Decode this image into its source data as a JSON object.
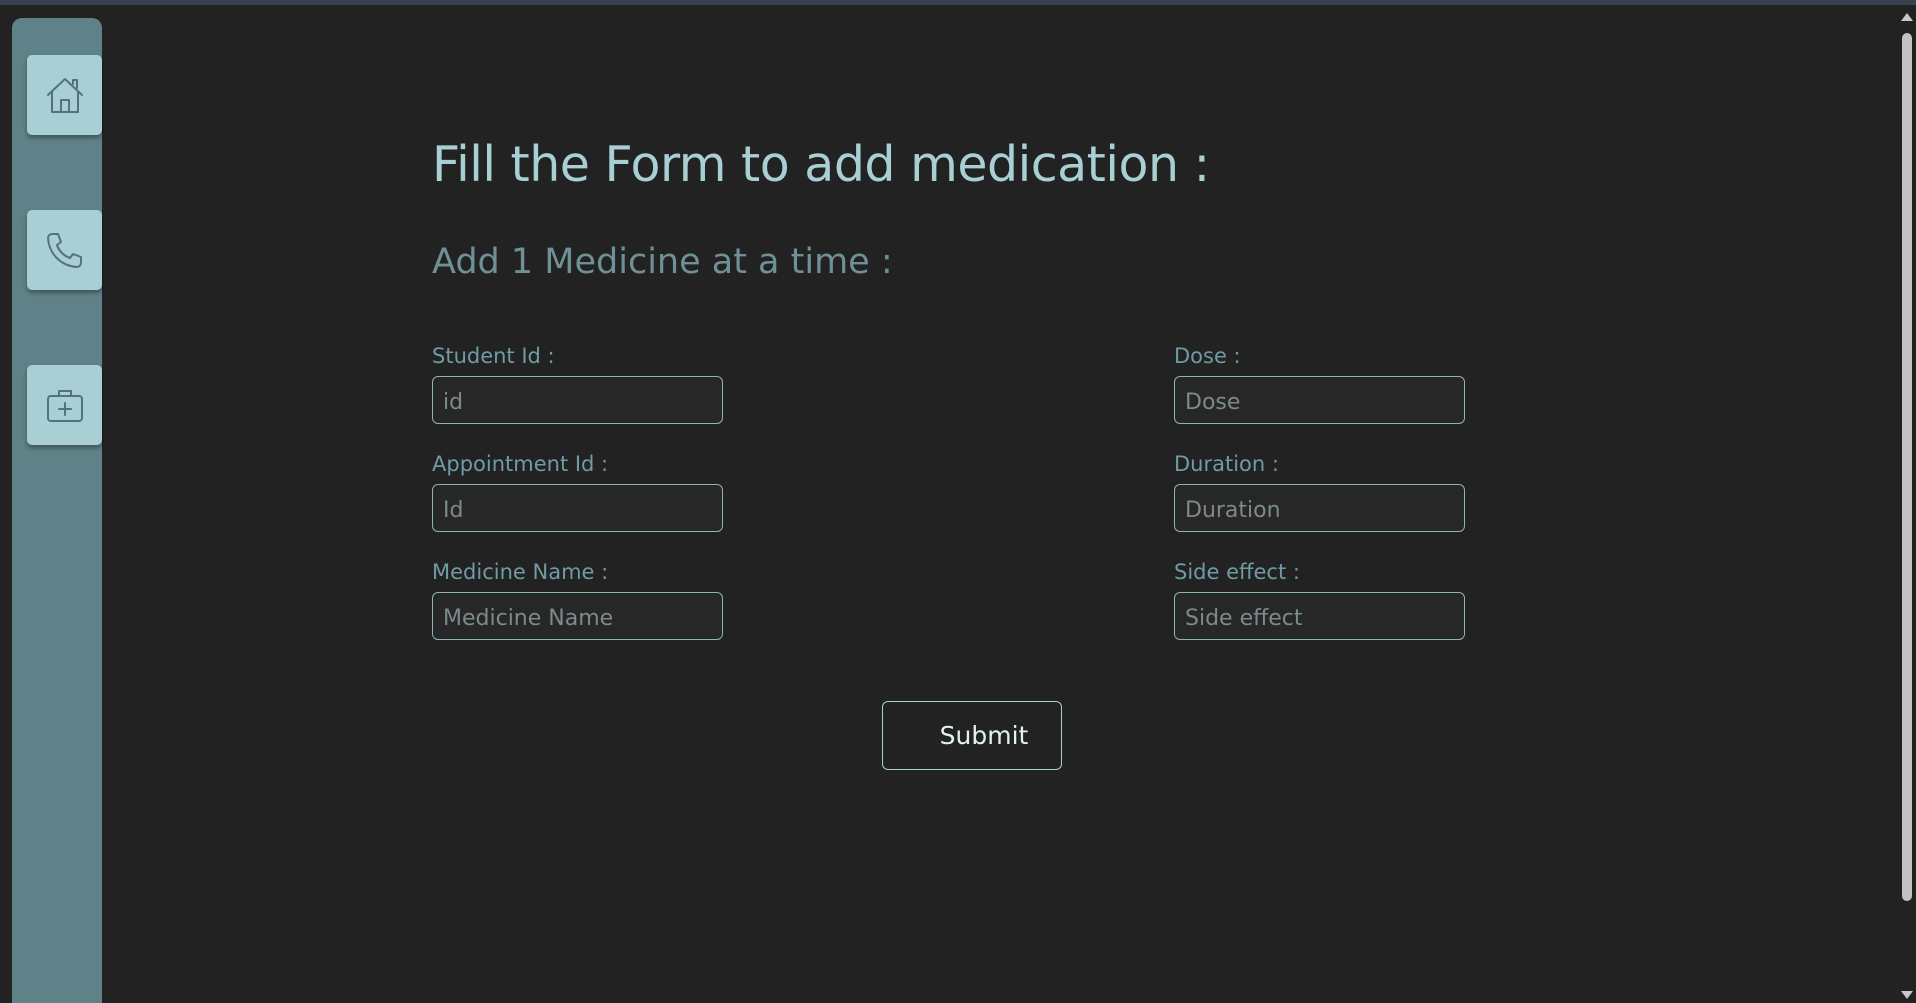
{
  "sidebar": {
    "items": [
      {
        "icon": "home-icon"
      },
      {
        "icon": "phone-icon"
      },
      {
        "icon": "medical-kit-icon"
      }
    ]
  },
  "form": {
    "title": "Fill the Form to add medication :",
    "subtitle": "Add 1 Medicine at a time :",
    "fields": {
      "student_id": {
        "label": "Student Id :",
        "placeholder": "id",
        "value": ""
      },
      "appointment_id": {
        "label": "Appointment Id :",
        "placeholder": "Id",
        "value": ""
      },
      "medicine_name": {
        "label": "Medicine Name :",
        "placeholder": "Medicine Name",
        "value": ""
      },
      "dose": {
        "label": "Dose :",
        "placeholder": "Dose",
        "value": ""
      },
      "duration": {
        "label": "Duration :",
        "placeholder": "Duration",
        "value": ""
      },
      "side_effect": {
        "label": "Side effect :",
        "placeholder": "Side effect",
        "value": ""
      }
    },
    "submit_label": "Submit"
  },
  "colors": {
    "background": "#222222",
    "sidebar": "#5f8288",
    "sidebar_button": "#a7cfd4",
    "accent": "#a7cfd4",
    "label": "#6f9ca4",
    "input_border": "#8fb3b8"
  }
}
